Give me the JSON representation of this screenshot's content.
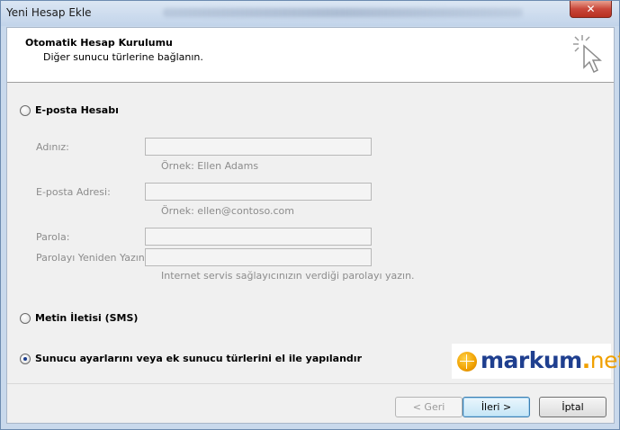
{
  "window": {
    "title": "Yeni Hesap Ekle",
    "close_label": "✕"
  },
  "header": {
    "title": "Otomatik Hesap Kurulumu",
    "subtitle": "Diğer sunucu türlerine bağlanın."
  },
  "options": {
    "email": {
      "label": "E-posta Hesabı",
      "selected": false
    },
    "sms": {
      "label": "Metin İletisi (SMS)",
      "selected": false
    },
    "manual": {
      "label": "Sunucu ayarlarını veya ek sunucu türlerini el ile yapılandır",
      "selected": true
    }
  },
  "fields": {
    "name": {
      "label": "Adınız:",
      "value": "",
      "hint": "Örnek: Ellen Adams"
    },
    "email": {
      "label": "E-posta Adresi:",
      "value": "",
      "hint": "Örnek: ellen@contoso.com"
    },
    "password": {
      "label": "Parola:",
      "value": ""
    },
    "password_confirm": {
      "label": "Parolayı Yeniden Yazın:",
      "value": "",
      "hint": "Internet servis sağlayıcınızın verdiği parolayı yazın."
    }
  },
  "logo": {
    "brand": "markum",
    "dot": ".",
    "suffix": "net"
  },
  "buttons": {
    "back": "< Geri",
    "next": "İleri >",
    "cancel": "İptal"
  },
  "colors": {
    "accent": "#1f3f8f",
    "logo_orange": "#f0a000"
  }
}
